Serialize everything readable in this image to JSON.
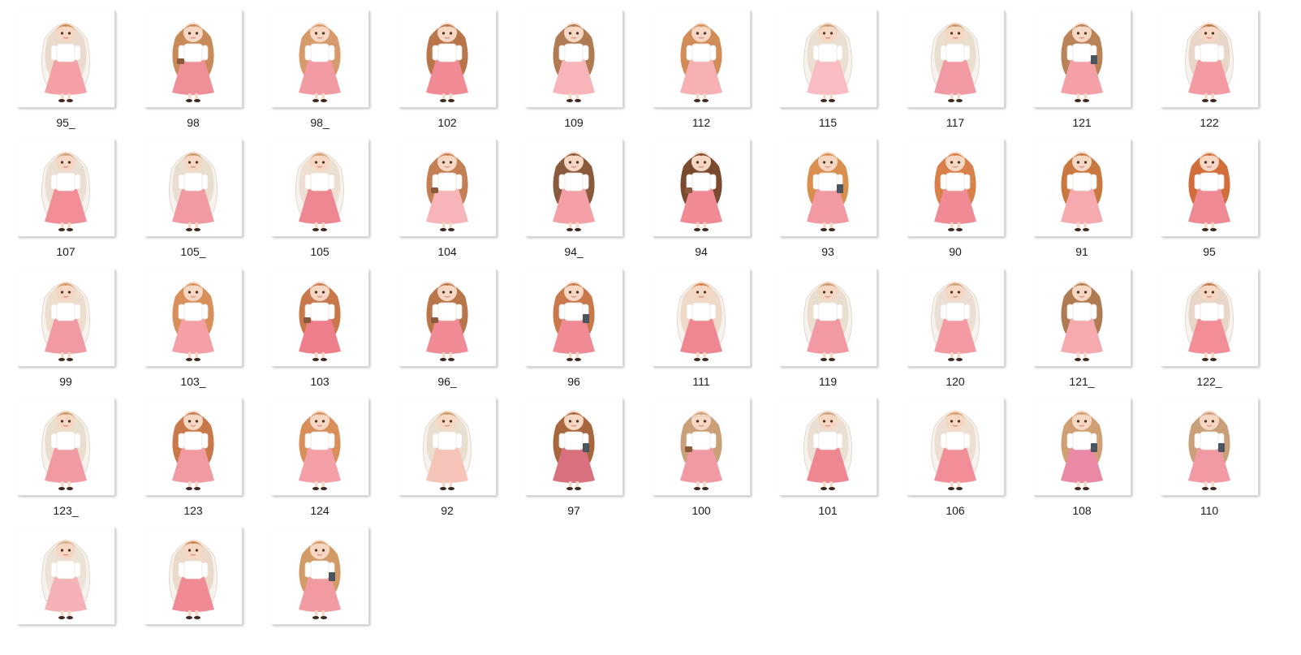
{
  "window": {
    "view": "large-icons"
  },
  "files": [
    {
      "name": "95_",
      "hair": "#c98a5a",
      "veil": true,
      "prop": "none",
      "skirt": "#f4a0a6"
    },
    {
      "name": "98",
      "hair": "#c98a5a",
      "veil": false,
      "prop": "bag",
      "skirt": "#ef8f98"
    },
    {
      "name": "98_",
      "hair": "#d79a6a",
      "veil": false,
      "prop": "none",
      "skirt": "#f19aa2"
    },
    {
      "name": "102",
      "hair": "#b9764a",
      "veil": false,
      "prop": "none",
      "skirt": "#f08a94"
    },
    {
      "name": "109",
      "hair": "#b07a52",
      "veil": false,
      "prop": "none",
      "skirt": "#f7b5ba"
    },
    {
      "name": "112",
      "hair": "#d28c57",
      "veil": false,
      "prop": "none",
      "skirt": "#f6b0b4"
    },
    {
      "name": "115",
      "hair": "#c9a07a",
      "veil": true,
      "prop": "none",
      "skirt": "#f8bcc2"
    },
    {
      "name": "117",
      "hair": "#c49a6c",
      "veil": true,
      "prop": "none",
      "skirt": "#f29aa4"
    },
    {
      "name": "121",
      "hair": "#b98357",
      "veil": false,
      "prop": "book",
      "skirt": "#f4a0a6"
    },
    {
      "name": "122",
      "hair": "#b9764a",
      "veil": true,
      "prop": "none",
      "skirt": "#f39aa2"
    },
    {
      "name": "107",
      "hair": "#c8a27c",
      "veil": true,
      "prop": "none",
      "skirt": "#f28e98"
    },
    {
      "name": "105_",
      "hair": "#c49a6c",
      "veil": true,
      "prop": "none",
      "skirt": "#f19aa2"
    },
    {
      "name": "105",
      "hair": "#cfa074",
      "veil": true,
      "prop": "none",
      "skirt": "#ee8792"
    },
    {
      "name": "104",
      "hair": "#c48054",
      "veil": false,
      "prop": "bag",
      "skirt": "#f7b5ba"
    },
    {
      "name": "94_",
      "hair": "#8a5a3c",
      "veil": false,
      "prop": "none",
      "skirt": "#f4a0a6"
    },
    {
      "name": "94",
      "hair": "#7a4a30",
      "veil": false,
      "prop": "bag",
      "skirt": "#f08a94"
    },
    {
      "name": "93",
      "hair": "#d9904f",
      "veil": false,
      "prop": "book",
      "skirt": "#f19aa2"
    },
    {
      "name": "90",
      "hair": "#d9804a",
      "veil": false,
      "prop": "none",
      "skirt": "#f08a94"
    },
    {
      "name": "91",
      "hair": "#c9783f",
      "veil": false,
      "prop": "none",
      "skirt": "#f6a9ae"
    },
    {
      "name": "95",
      "hair": "#d26e3c",
      "veil": false,
      "prop": "none",
      "skirt": "#ef8a94"
    },
    {
      "name": "99",
      "hair": "#cf9a66",
      "veil": true,
      "prop": "none",
      "skirt": "#f29aa4"
    },
    {
      "name": "103_",
      "hair": "#d98f5a",
      "veil": false,
      "prop": "none",
      "skirt": "#f4a0a6"
    },
    {
      "name": "103",
      "hair": "#c8784a",
      "veil": false,
      "prop": "bag",
      "skirt": "#ee7f8a"
    },
    {
      "name": "96_",
      "hair": "#b9764a",
      "veil": false,
      "prop": "bag",
      "skirt": "#f08a94"
    },
    {
      "name": "96",
      "hair": "#c8784a",
      "veil": false,
      "prop": "book",
      "skirt": "#f08a94"
    },
    {
      "name": "111",
      "hair": "#d9804a",
      "veil": true,
      "prop": "none",
      "skirt": "#ef8792"
    },
    {
      "name": "119",
      "hair": "#c49a6c",
      "veil": true,
      "prop": "none",
      "skirt": "#f29aa4"
    },
    {
      "name": "120",
      "hair": "#c8a27c",
      "veil": true,
      "prop": "none",
      "skirt": "#f39aa2"
    },
    {
      "name": "121_",
      "hair": "#b07a52",
      "veil": false,
      "prop": "none",
      "skirt": "#f6a9ae"
    },
    {
      "name": "122_",
      "hair": "#b9764a",
      "veil": true,
      "prop": "none",
      "skirt": "#f28e98"
    },
    {
      "name": "123_",
      "hair": "#c49a6c",
      "veil": true,
      "prop": "none",
      "skirt": "#f29aa4"
    },
    {
      "name": "123",
      "hair": "#c8784a",
      "veil": false,
      "prop": "none",
      "skirt": "#f19aa2"
    },
    {
      "name": "124",
      "hair": "#d98f5a",
      "veil": false,
      "prop": "none",
      "skirt": "#f4a0a6"
    },
    {
      "name": "92",
      "hair": "#c49a6c",
      "veil": true,
      "prop": "none",
      "skirt": "#f6c3b8"
    },
    {
      "name": "97",
      "hair": "#a8663e",
      "veil": false,
      "prop": "book",
      "skirt": "#d8707e"
    },
    {
      "name": "100",
      "hair": "#c9a07a",
      "veil": false,
      "prop": "bag",
      "skirt": "#f29aa4"
    },
    {
      "name": "101",
      "hair": "#c8a27c",
      "veil": true,
      "prop": "none",
      "skirt": "#ee8792"
    },
    {
      "name": "106",
      "hair": "#cfa074",
      "veil": true,
      "prop": "none",
      "skirt": "#f28e98"
    },
    {
      "name": "108",
      "hair": "#d0a074",
      "veil": false,
      "prop": "book",
      "skirt": "#e989a4"
    },
    {
      "name": "110",
      "hair": "#c9a07a",
      "veil": false,
      "prop": "book",
      "skirt": "#f29aa4"
    },
    {
      "name": "",
      "hair": "#d0b08c",
      "veil": true,
      "prop": "none",
      "skirt": "#f5b2b6"
    },
    {
      "name": "",
      "hair": "#c8844f",
      "veil": true,
      "prop": "none",
      "skirt": "#f08a94"
    },
    {
      "name": "",
      "hair": "#d29a66",
      "veil": false,
      "prop": "book",
      "skirt": "#f19aa2"
    }
  ]
}
